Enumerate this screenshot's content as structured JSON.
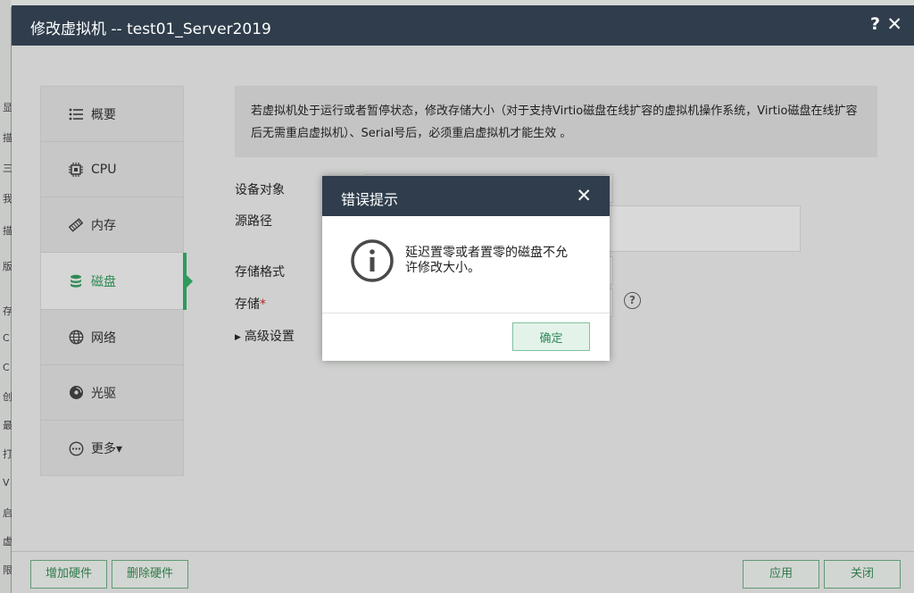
{
  "window": {
    "title": "修改虚拟机 -- test01_Server2019",
    "help_glyph": "?",
    "close_glyph": "✕"
  },
  "background_left_chars": [
    "显",
    "描",
    "三",
    "我",
    "描",
    "版",
    "存",
    "C",
    "C",
    "创",
    "最",
    "打",
    "V",
    "启",
    "虚",
    "限"
  ],
  "sidebar": {
    "items": [
      {
        "label": "概要",
        "icon": "list-icon"
      },
      {
        "label": "CPU",
        "icon": "cpu-icon"
      },
      {
        "label": "内存",
        "icon": "memory-icon"
      },
      {
        "label": "磁盘",
        "icon": "disk-icon"
      },
      {
        "label": "网络",
        "icon": "globe-icon"
      },
      {
        "label": "光驱",
        "icon": "cd-icon"
      },
      {
        "label": "更多▾",
        "icon": "more-icon"
      }
    ],
    "active_index": 3
  },
  "notice": {
    "text": "若虚拟机处于运行或者暂停状态，修改存储大小（对于支持Virtio磁盘在线扩容的虚拟机操作系统，Virtio磁盘在线扩容后无需重启虚拟机）、Serial号后，必须重启虚拟机才能生效 。"
  },
  "form": {
    "device_label": "设备对象",
    "source_path_label": "源路径",
    "storage_format_label": "存储格式",
    "storage_label": "存储",
    "required_mark": "*",
    "advanced_label": "高级设置",
    "help_glyph": "?"
  },
  "footer": {
    "add_hw": "增加硬件",
    "del_hw": "删除硬件",
    "apply": "应用",
    "close": "关闭"
  },
  "error_modal": {
    "title": "错误提示",
    "close_glyph": "✕",
    "message": "延迟置零或者置零的磁盘不允许修改大小。",
    "ok": "确定"
  },
  "colors": {
    "titlebar": "#2f3d4c",
    "accent_green": "#2f9a5c",
    "ok_bg": "#e3f3ea"
  }
}
